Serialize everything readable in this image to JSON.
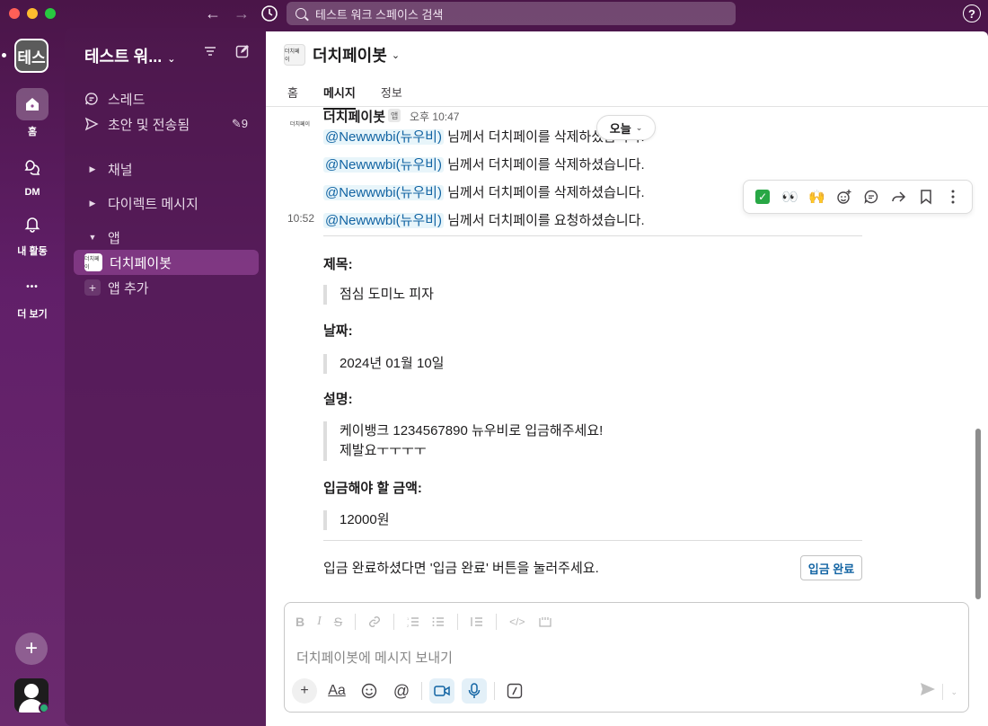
{
  "titlebar": {
    "search_placeholder": "테스트 워크 스페이스 검색",
    "help": "?"
  },
  "rail": {
    "workspace_avatar": "테스",
    "home_label": "홈",
    "dm_label": "DM",
    "activity_label": "내 활동",
    "more_label": "더 보기",
    "more_glyph": "•••"
  },
  "sidebar": {
    "workspace_name": "테스트 워...",
    "threads": "스레드",
    "drafts": "초안 및 전송됨",
    "drafts_count": "9",
    "channels": "채널",
    "direct_messages": "다이렉트 메시지",
    "apps": "앱",
    "app_item": "더치페이봇",
    "add_app": "앱 추가",
    "app_thumb_text": "더치페이"
  },
  "channel": {
    "title": "더치페이봇",
    "tabs": [
      "홈",
      "메시지",
      "정보"
    ],
    "avatar_text": "더치페이"
  },
  "message": {
    "sender": "더치페이봇",
    "app_badge": "앱",
    "time": "오후 10:47",
    "today": "오늘",
    "side_time": "10:52",
    "lines": [
      {
        "mention": "@Newwwbi(뉴우비)",
        "text": " 님께서 더치페이를 삭제하셨습니다."
      },
      {
        "mention": "@Newwwbi(뉴우비)",
        "text": " 님께서 더치페이를 삭제하셨습니다."
      },
      {
        "mention": "@Newwwbi(뉴우비)",
        "text": " 님께서 더치페이를 삭제하셨습니다."
      },
      {
        "mention": "@Newwwbi(뉴우비)",
        "text": " 님께서 더치페이를 요청하셨습니다."
      }
    ],
    "fields": {
      "title_label": "제목:",
      "title_value": "점심 도미노 피자",
      "date_label": "날짜:",
      "date_value": "2024년 01월 10일",
      "desc_label": "설명:",
      "desc_line1": "케이뱅크 1234567890 뉴우비로 입금해주세요!",
      "desc_line2": "제발요ㅜㅜㅜㅜ",
      "amount_label": "입금해야 할 금액:",
      "amount_value": "12000원"
    },
    "footer": "입금 완료하셨다면 '입금 완료' 버튼을 눌러주세요.",
    "deposit_button": "입금 완료"
  },
  "hover_toolbar": {
    "check": "✓",
    "eyes": "👀",
    "clap": "🙌"
  },
  "composer": {
    "placeholder": "더치페이봇에 메시지 보내기"
  }
}
